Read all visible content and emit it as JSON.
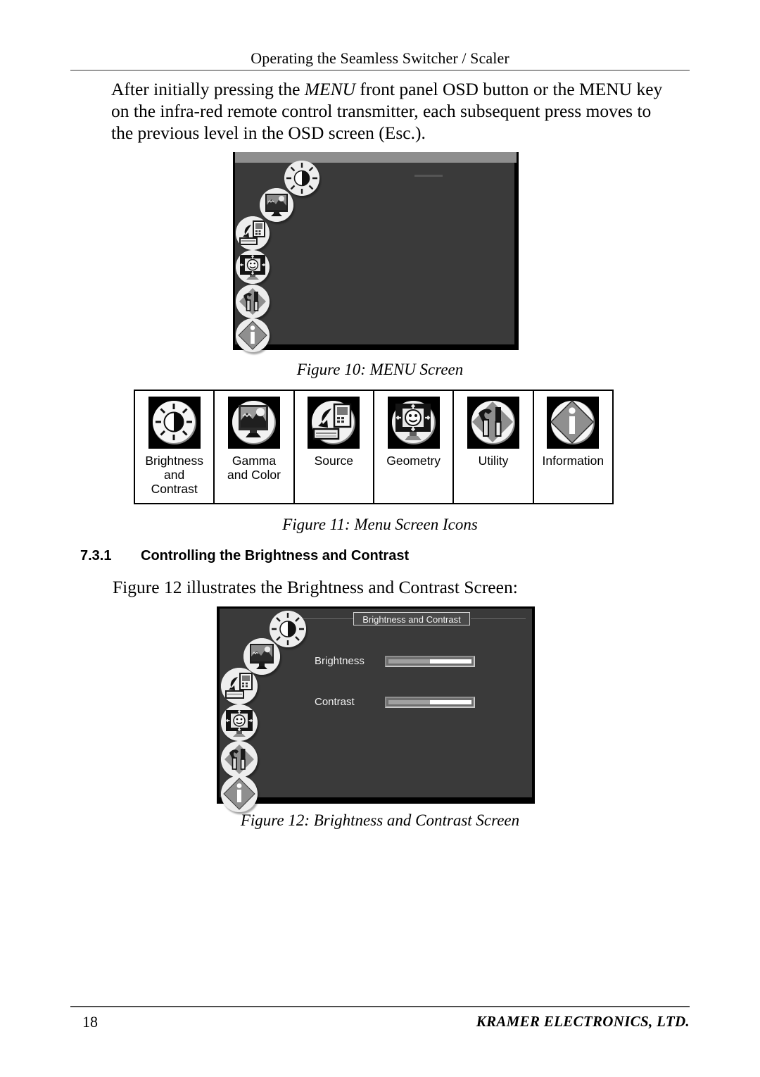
{
  "document": {
    "running_head": "Operating the Seamless Switcher / Scaler",
    "page_number": "18",
    "company": "KRAMER ELECTRONICS, LTD."
  },
  "body": {
    "paragraph_part1": "After initially pressing the ",
    "paragraph_menu_italic": "MENU",
    "paragraph_part2": " front panel OSD button or the MENU key on the infra-red remote control transmitter, each subsequent press moves to the previous level in the OSD screen (Esc.)."
  },
  "figure10": {
    "caption": "Figure 10: MENU Screen",
    "icons": [
      {
        "name": "brightness-contrast-osd-icon",
        "label": "Brightness and Contrast"
      },
      {
        "name": "gamma-color-osd-icon",
        "label": "Gamma and Color"
      },
      {
        "name": "source-osd-icon",
        "label": "Source"
      },
      {
        "name": "geometry-osd-icon",
        "label": "Geometry"
      },
      {
        "name": "utility-osd-icon",
        "label": "Utility"
      },
      {
        "name": "information-osd-icon",
        "label": "Information"
      }
    ]
  },
  "figure11": {
    "caption": "Figure 11: Menu Screen Icons",
    "cells": [
      {
        "icon": "brightness-icon",
        "label": "Brightness\nand\nContrast"
      },
      {
        "icon": "gamma-color-icon",
        "label": "Gamma\nand Color"
      },
      {
        "icon": "source-icon",
        "label": "Source"
      },
      {
        "icon": "geometry-icon",
        "label": "Geometry"
      },
      {
        "icon": "utility-icon",
        "label": "Utility"
      },
      {
        "icon": "information-icon",
        "label": "Information"
      }
    ]
  },
  "section": {
    "number": "7.3.1",
    "title": "Controlling the Brightness and Contrast",
    "intro": "Figure 12 illustrates the Brightness and Contrast Screen:"
  },
  "figure12": {
    "caption": "Figure 12: Brightness and Contrast Screen",
    "osd_title": "Brightness and Contrast",
    "controls": [
      {
        "label": "Brightness",
        "value_percent": 50
      },
      {
        "label": "Contrast",
        "value_percent": 50
      }
    ]
  },
  "colors": {
    "osd_background": "#3a3a3a",
    "osd_titlebar": "#8e8e8e",
    "osd_text": "#f0f0f0",
    "slider_fill": "#a0a0a0",
    "slider_groove": "#ffffff",
    "rule": "#9a9a9a"
  }
}
